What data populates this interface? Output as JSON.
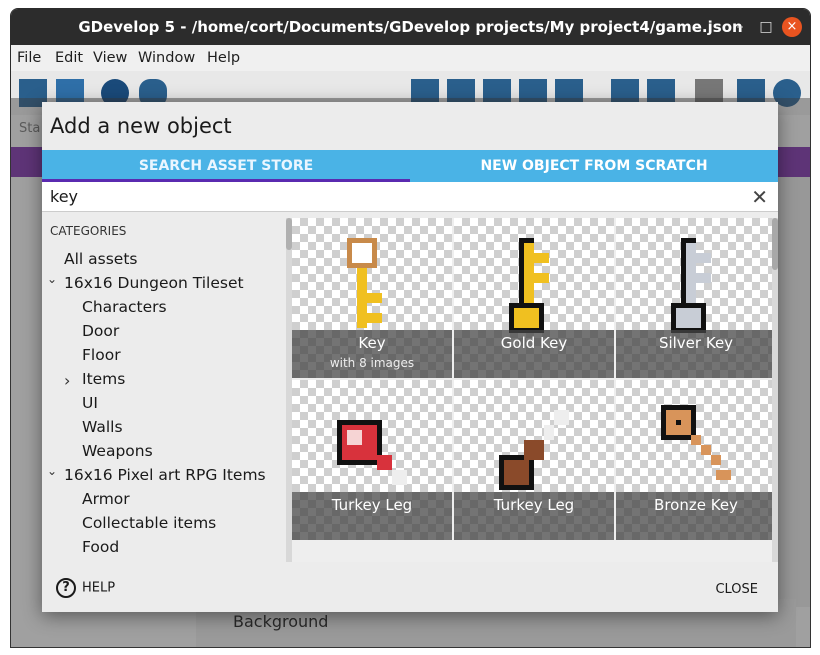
{
  "window": {
    "title": "GDevelop 5 - /home/cort/Documents/GDevelop projects/My project4/game.json"
  },
  "menu": [
    "File",
    "Edit",
    "View",
    "Window",
    "Help"
  ],
  "background": {
    "status_stub": "Sta",
    "layer_label": "Background"
  },
  "dialog": {
    "title": "Add a new object",
    "tabs": [
      "SEARCH ASSET STORE",
      "NEW OBJECT FROM SCRATCH"
    ],
    "search_value": "key",
    "categories_heading": "CATEGORIES",
    "categories": [
      {
        "label": "All assets",
        "level": 0,
        "chevron": ""
      },
      {
        "label": "16x16 Dungeon Tileset",
        "level": 0,
        "chevron": "down"
      },
      {
        "label": "Characters",
        "level": 1,
        "chevron": ""
      },
      {
        "label": "Door",
        "level": 1,
        "chevron": ""
      },
      {
        "label": "Floor",
        "level": 1,
        "chevron": ""
      },
      {
        "label": "Items",
        "level": 1,
        "chevron": "right"
      },
      {
        "label": "UI",
        "level": 1,
        "chevron": ""
      },
      {
        "label": "Walls",
        "level": 1,
        "chevron": ""
      },
      {
        "label": "Weapons",
        "level": 1,
        "chevron": ""
      },
      {
        "label": "16x16 Pixel art RPG Items",
        "level": 0,
        "chevron": "down"
      },
      {
        "label": "Armor",
        "level": 1,
        "chevron": ""
      },
      {
        "label": "Collectable items",
        "level": 1,
        "chevron": ""
      },
      {
        "label": "Food",
        "level": 1,
        "chevron": ""
      }
    ],
    "assets": [
      {
        "name": "Key",
        "sub": "with 8 images",
        "icon": "key-icon",
        "color": "#f0c020"
      },
      {
        "name": "Gold Key",
        "sub": "",
        "icon": "gold-key-icon",
        "color": "#f0c020"
      },
      {
        "name": "Silver Key",
        "sub": "",
        "icon": "silver-key-icon",
        "color": "#c8cdd6"
      },
      {
        "name": "Turkey Leg",
        "sub": "",
        "icon": "meat-icon",
        "color": "#d8323c"
      },
      {
        "name": "Turkey Leg",
        "sub": "",
        "icon": "turkey-leg-icon",
        "color": "#8a4a2a"
      },
      {
        "name": "Bronze Key",
        "sub": "",
        "icon": "bronze-key-icon",
        "color": "#d8945a"
      }
    ],
    "help_label": "HELP",
    "close_label": "CLOSE"
  }
}
